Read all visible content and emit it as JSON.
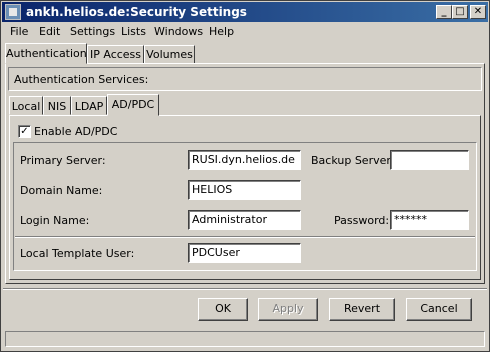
{
  "window": {
    "title": "ankh.helios.de:Security Settings"
  },
  "menu": [
    "File",
    "Edit",
    "Settings",
    "Lists",
    "Windows",
    "Help"
  ],
  "main_tabs": [
    {
      "label": "Authentication",
      "active": true
    },
    {
      "label": "IP Access",
      "active": false
    },
    {
      "label": "Volumes",
      "active": false
    }
  ],
  "section_title": "Authentication Services:",
  "service_tabs": [
    {
      "label": "Local",
      "active": false
    },
    {
      "label": "NIS",
      "active": false
    },
    {
      "label": "LDAP",
      "active": false
    },
    {
      "label": "AD/PDC",
      "active": true
    }
  ],
  "form": {
    "enable_label": "Enable AD/PDC",
    "enable_checked": "✓",
    "primary_server_label": "Primary Server:",
    "primary_server_value": "RUSI.dyn.helios.de",
    "backup_server_label": "Backup Server:",
    "backup_server_value": "",
    "domain_name_label": "Domain Name:",
    "domain_name_value": "HELIOS",
    "login_name_label": "Login Name:",
    "login_name_value": "Administrator",
    "password_label": "Password:",
    "password_value": "******",
    "template_user_label": "Local Template User:",
    "template_user_value": "PDCUser"
  },
  "buttons": {
    "ok": "OK",
    "apply": "Apply",
    "revert": "Revert",
    "cancel": "Cancel"
  },
  "status_text": ""
}
